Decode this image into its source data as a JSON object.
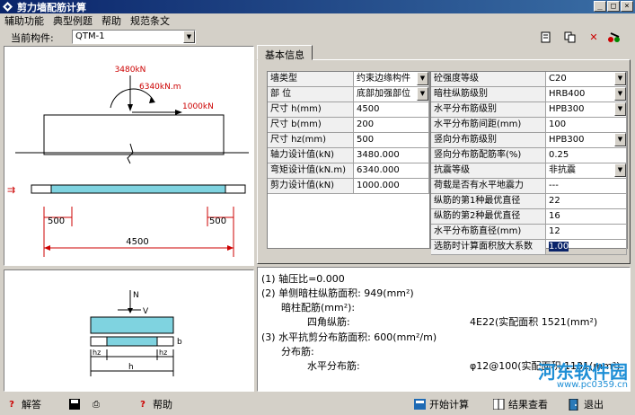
{
  "window": {
    "title": "剪力墙配筋计算",
    "buttons": [
      "_",
      "□",
      "×"
    ]
  },
  "menu": [
    "辅助功能",
    "典型例题",
    "帮助",
    "规范条文"
  ],
  "toolbar": {
    "component_label": "当前构件:",
    "component_value": "QTM-1"
  },
  "drawing": {
    "load_n": "3480kN",
    "load_m": "6340kN.m",
    "load_v": "1000kN",
    "dim_left": "500",
    "dim_right": "500",
    "dim_total": "4500"
  },
  "section": {
    "label_n": "N",
    "label_v": "V",
    "label_h": "h",
    "label_b": "b",
    "label_hz1": "hz",
    "label_hz2": "hz"
  },
  "tab": {
    "label": "基本信息"
  },
  "left_grid": [
    {
      "label": "墙类型",
      "value": "约束边缘构件",
      "dropdown": true
    },
    {
      "label": "部 位",
      "value": "底部加强部位",
      "dropdown": true
    },
    {
      "label": "尺寸 h(mm)",
      "value": "4500"
    },
    {
      "label": "尺寸 b(mm)",
      "value": "200"
    },
    {
      "label": "尺寸 hz(mm)",
      "value": "500"
    },
    {
      "label": "轴力设计值(kN)",
      "value": "3480.000"
    },
    {
      "label": "弯矩设计值(kN.m)",
      "value": "6340.000"
    },
    {
      "label": "剪力设计值(kN)",
      "value": "1000.000"
    }
  ],
  "right_grid": [
    {
      "label": "砼强度等级",
      "value": "C20",
      "dropdown": true
    },
    {
      "label": "暗柱纵筋级别",
      "value": "HRB400",
      "dropdown": true
    },
    {
      "label": "水平分布筋级别",
      "value": "HPB300",
      "dropdown": true
    },
    {
      "label": "水平分布筋间距(mm)",
      "value": "100"
    },
    {
      "label": "竖向分布筋级别",
      "value": "HPB300",
      "dropdown": true
    },
    {
      "label": "竖向分布筋配筋率(%)",
      "value": "0.25"
    },
    {
      "label": "抗震等级",
      "value": "非抗震",
      "dropdown": true
    },
    {
      "label": "荷载是否有水平地震力",
      "value": "---"
    },
    {
      "label": "纵筋的第1种最优直径",
      "value": "22"
    },
    {
      "label": "纵筋的第2种最优直径",
      "value": "16"
    },
    {
      "label": "水平分布筋直径(mm)",
      "value": "12"
    },
    {
      "label": "选筋时计算面积放大系数",
      "value": "1.00",
      "selected": true
    }
  ],
  "results": {
    "l1": "(1) 轴压比=0.000",
    "l2": "(2) 单侧暗柱纵筋面积: 949(mm²)",
    "l3": "暗柱配筋(mm²):",
    "l4a": "四角纵筋:",
    "l4b": "4E22(实配面积 1521(mm²)",
    "l5": "(3) 水平抗剪分布筋面积: 600(mm²/m)",
    "l6": "分布筋:",
    "l7a": "水平分布筋:",
    "l7b": "φ12@100(实配面积 1131(mm²)"
  },
  "statusbar": {
    "help": "解答",
    "help2": "帮助",
    "start": "开始计算",
    "view": "结果查看",
    "exit": "退出"
  },
  "watermark": {
    "text": "河东软件园",
    "url": "www.pc0359.cn"
  },
  "colors": {
    "title_start": "#0a246a",
    "title_end": "#3a6ea5",
    "wall_fill": "#7fd3e0",
    "selected_bg": "#0a246a"
  }
}
